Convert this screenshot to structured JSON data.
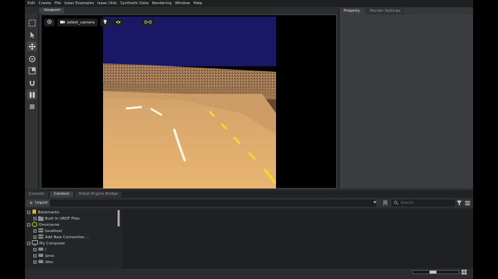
{
  "menu": [
    "Edit",
    "Create",
    "File",
    "Isaac Examples",
    "Isaac Utils",
    "Synthetic Data",
    "Rendering",
    "Window",
    "Help"
  ],
  "viewport": {
    "tab_label": "Viewport",
    "camera_label": "jetbot_camera"
  },
  "right_panel": {
    "tabs": [
      "Property",
      "Render Settings"
    ]
  },
  "bottom": {
    "tabs": [
      "Console",
      "Content",
      "Robot Engine Bridge"
    ],
    "import_label": "Import",
    "search_placeholder": "Search",
    "tree": [
      {
        "label": "Bookmarks",
        "level": 0,
        "icon": "bookmark-icon",
        "expanded": true
      },
      {
        "label": "Built In URDF Files",
        "level": 1,
        "icon": "folder-icon",
        "expanded": false
      },
      {
        "label": "Omniverse",
        "level": 0,
        "icon": "omniverse-icon",
        "expanded": true
      },
      {
        "label": "localhost",
        "level": 1,
        "icon": "server-icon",
        "expanded": false
      },
      {
        "label": "Add New Connection ...",
        "level": 1,
        "icon": "server-icon",
        "expanded": false
      },
      {
        "label": "My Computer",
        "level": 0,
        "icon": "computer-icon",
        "expanded": true
      },
      {
        "label": "/",
        "level": 1,
        "icon": "drive-icon",
        "expanded": false
      },
      {
        "label": "/proc",
        "level": 1,
        "icon": "drive-icon",
        "expanded": false
      },
      {
        "label": "/dev",
        "level": 1,
        "icon": "drive-icon",
        "expanded": false
      }
    ]
  },
  "colors": {
    "accent_green": "#76b900",
    "sky": "#1a1866",
    "road": "#e0ae6a",
    "lane_yellow": "#f5d23a"
  }
}
